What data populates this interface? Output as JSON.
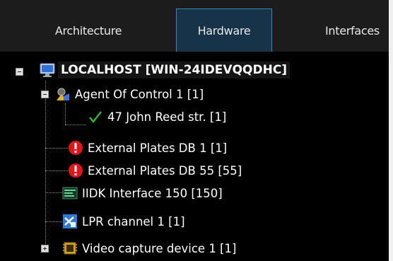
{
  "tabs": [
    {
      "label": "Architecture",
      "active": false
    },
    {
      "label": "Hardware",
      "active": true
    },
    {
      "label": "Interfaces",
      "active": false
    }
  ],
  "tree": {
    "root": {
      "label": "LOCALHOST [WIN-24IDEVQQDHC]",
      "icon": "monitor-icon",
      "expanded": true
    },
    "items": [
      {
        "label": "Agent Of Control 1 [1]",
        "icon": "agent-control-icon",
        "expanded": true
      },
      {
        "label": "47 John Reed str. [1]",
        "icon": "checkmark-icon"
      },
      {
        "label": "External Plates DB 1 [1]",
        "icon": "error-icon"
      },
      {
        "label": "External Plates DB 55 [55]",
        "icon": "error-icon"
      },
      {
        "label": "IIDK Interface 150 [150]",
        "icon": "interface-board-icon"
      },
      {
        "label": "LPR channel  1 [1]",
        "icon": "lpr-channel-icon"
      },
      {
        "label": "Video capture device 1 [1]",
        "icon": "video-capture-chip-icon",
        "expanded": false
      }
    ]
  },
  "colors": {
    "background": "#000000",
    "tab_active_border": "#3a86b6",
    "error": "#e0161b",
    "check": "#2fb52f"
  }
}
